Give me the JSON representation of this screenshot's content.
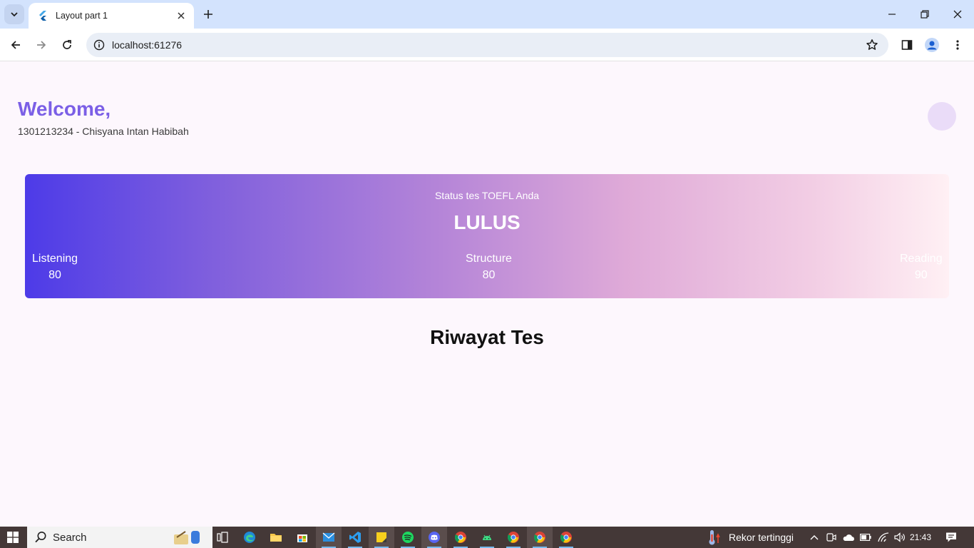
{
  "browser": {
    "tab_title": "Layout part 1",
    "url": "localhost:61276"
  },
  "page": {
    "welcome": "Welcome,",
    "user_line": "1301213234 - Chisyana Intan Habibah",
    "status": {
      "label": "Status tes TOEFL Anda",
      "value": "LULUS",
      "scores": [
        {
          "name": "Listening",
          "value": "80"
        },
        {
          "name": "Structure",
          "value": "80"
        },
        {
          "name": "Reading",
          "value": "90"
        }
      ]
    },
    "section_title": "Riwayat Tes"
  },
  "taskbar": {
    "search_label": "Search",
    "weather_text": "Rekor tertinggi",
    "time": "21:43"
  },
  "colors": {
    "accent": "#7b5fe6",
    "gradient_start": "#4d3be8",
    "gradient_end": "#fff0f4"
  }
}
